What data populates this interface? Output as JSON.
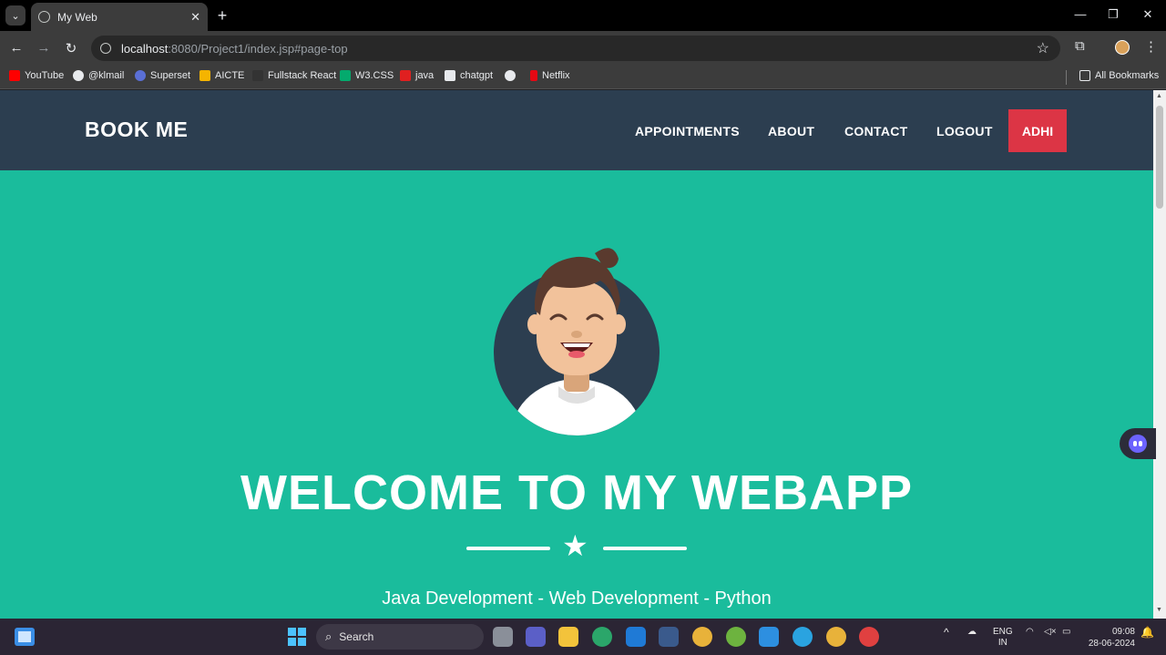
{
  "browser": {
    "tab_title": "My Web",
    "tab_close": "✕",
    "new_tab": "+",
    "url_host": "localhost",
    "url_rest": ":8080/Project1/index.jsp#page-top",
    "window_controls": [
      "—",
      "❐",
      "✕"
    ],
    "bookmarks": [
      {
        "label": "YouTube",
        "color": "#ff0000"
      },
      {
        "label": "@klmail",
        "color": "#e8eaed"
      },
      {
        "label": "Superset",
        "color": "#5a6fd6"
      },
      {
        "label": "AICTE",
        "color": "#f5b400"
      },
      {
        "label": "Fullstack React",
        "color": "#333333"
      },
      {
        "label": "W3.CSS",
        "color": "#04aa6d"
      },
      {
        "label": "java",
        "color": "#e02020"
      },
      {
        "label": "chatgpt",
        "color": "#e8eaed"
      },
      {
        "label": "",
        "color": "#e8eaed"
      },
      {
        "label": "Netflix",
        "color": "#e50914"
      }
    ],
    "all_bookmarks": "All Bookmarks"
  },
  "site": {
    "brand": "BOOK ME",
    "nav": [
      "APPOINTMENTS",
      "ABOUT",
      "CONTACT",
      "LOGOUT"
    ],
    "user_button": "ADHI",
    "hero_title": "WELCOME TO MY WEBAPP",
    "hero_subtitle": "Java Development - Web Development - Python",
    "colors": {
      "primary": "#1abc9c",
      "navbar": "#2c3e50",
      "accent": "#dc3545"
    }
  },
  "taskbar": {
    "search_placeholder": "Search",
    "lang_top": "ENG",
    "lang_bottom": "IN",
    "time": "09:08",
    "date": "28-06-2024"
  }
}
